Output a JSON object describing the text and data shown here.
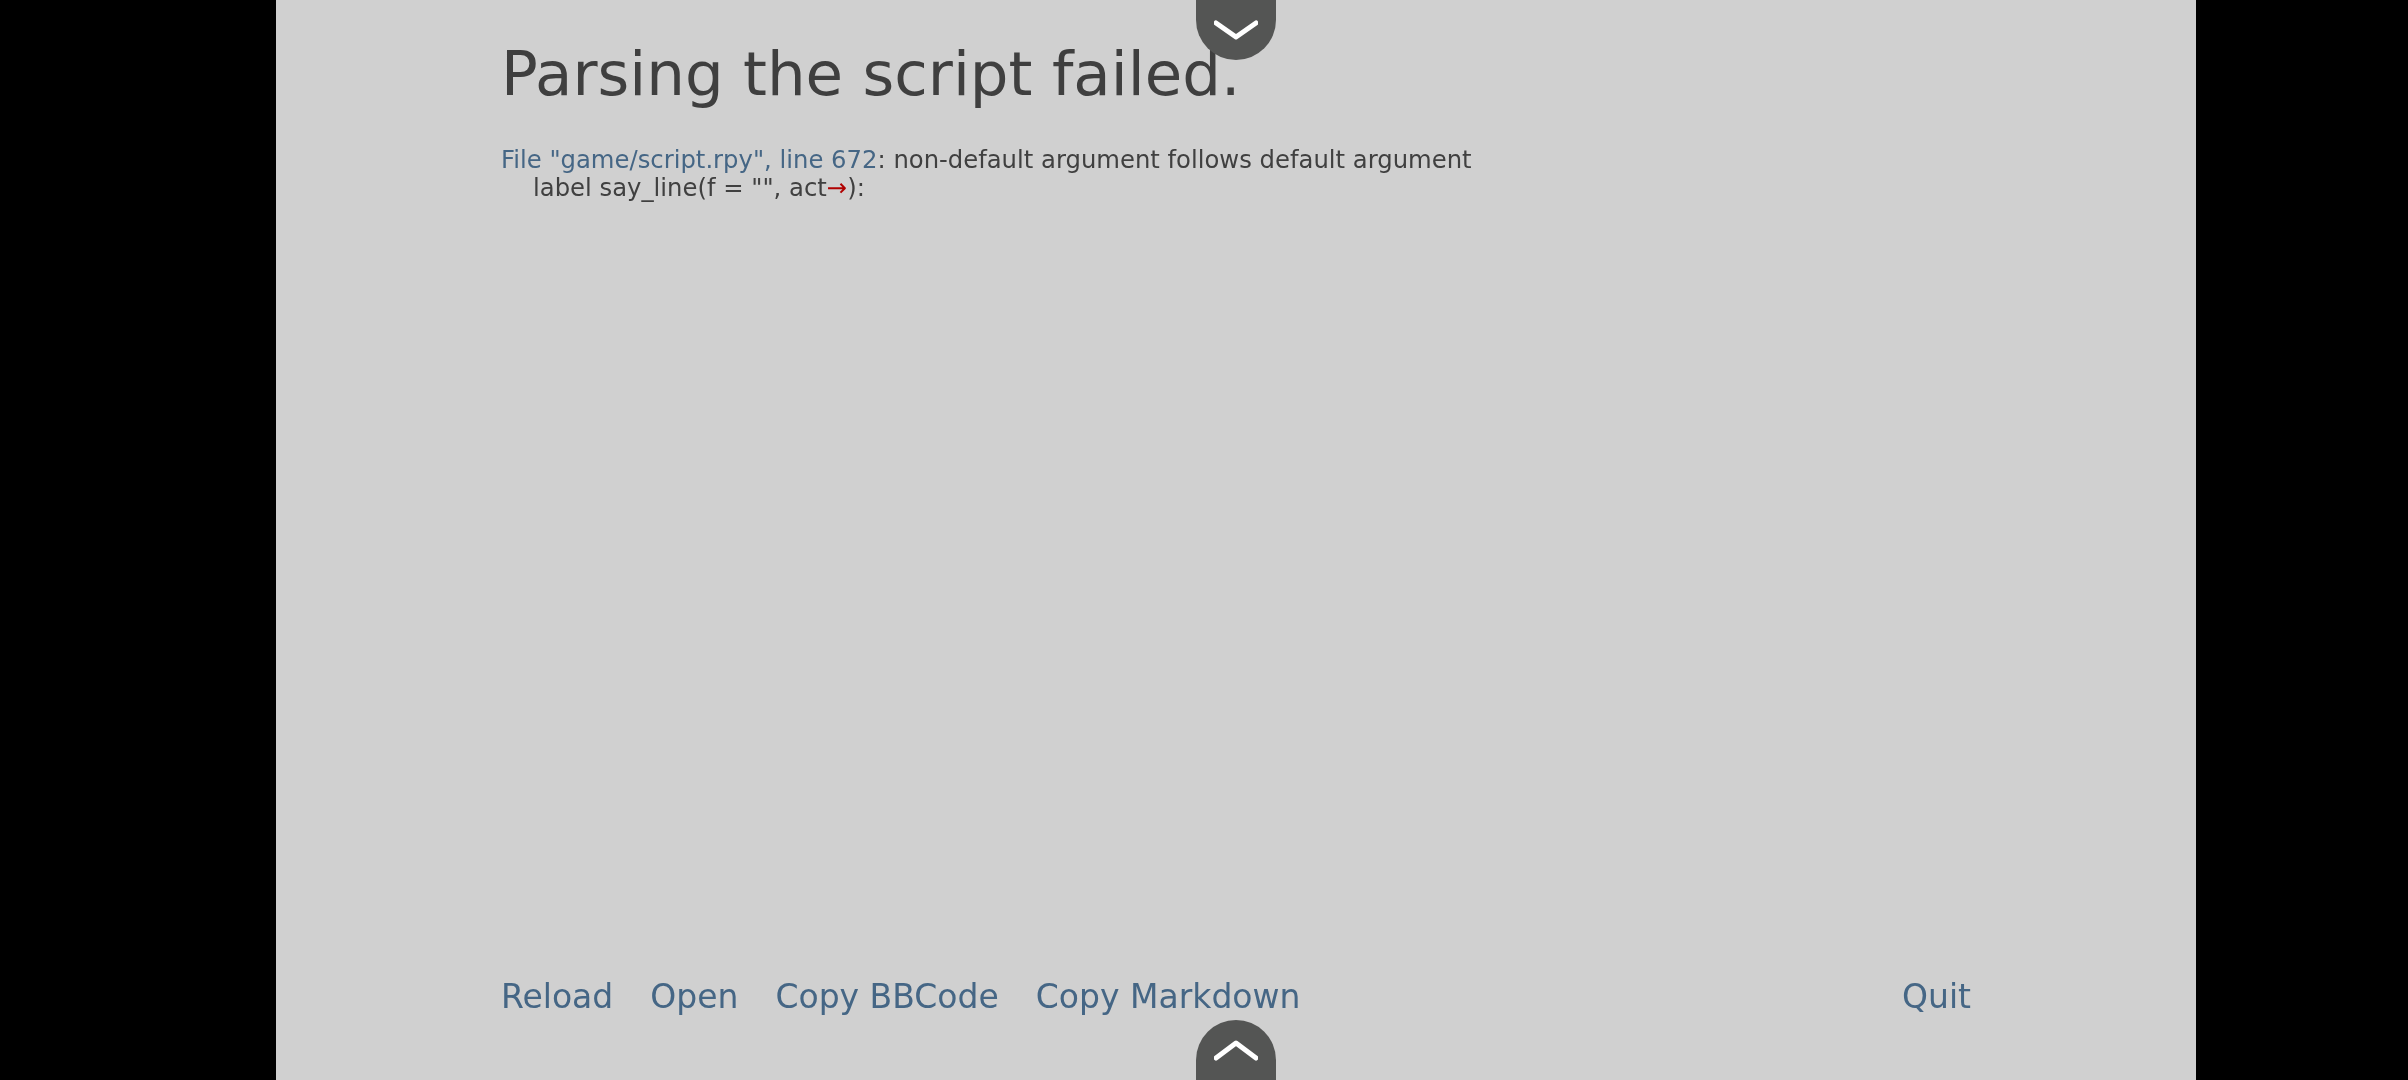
{
  "title": "Parsing the script failed.",
  "error": {
    "location": "File \"game/script.rpy\", line 672",
    "message": ": non-default argument follows default argument",
    "code_before": "label say_line(f = \"\", act",
    "marker": "→",
    "code_after": "):"
  },
  "actions": [
    {
      "label": "Reload"
    },
    {
      "label": "Open"
    },
    {
      "label": "Copy BBCode"
    },
    {
      "label": "Copy Markdown"
    }
  ],
  "quit": {
    "label": "Quit"
  }
}
